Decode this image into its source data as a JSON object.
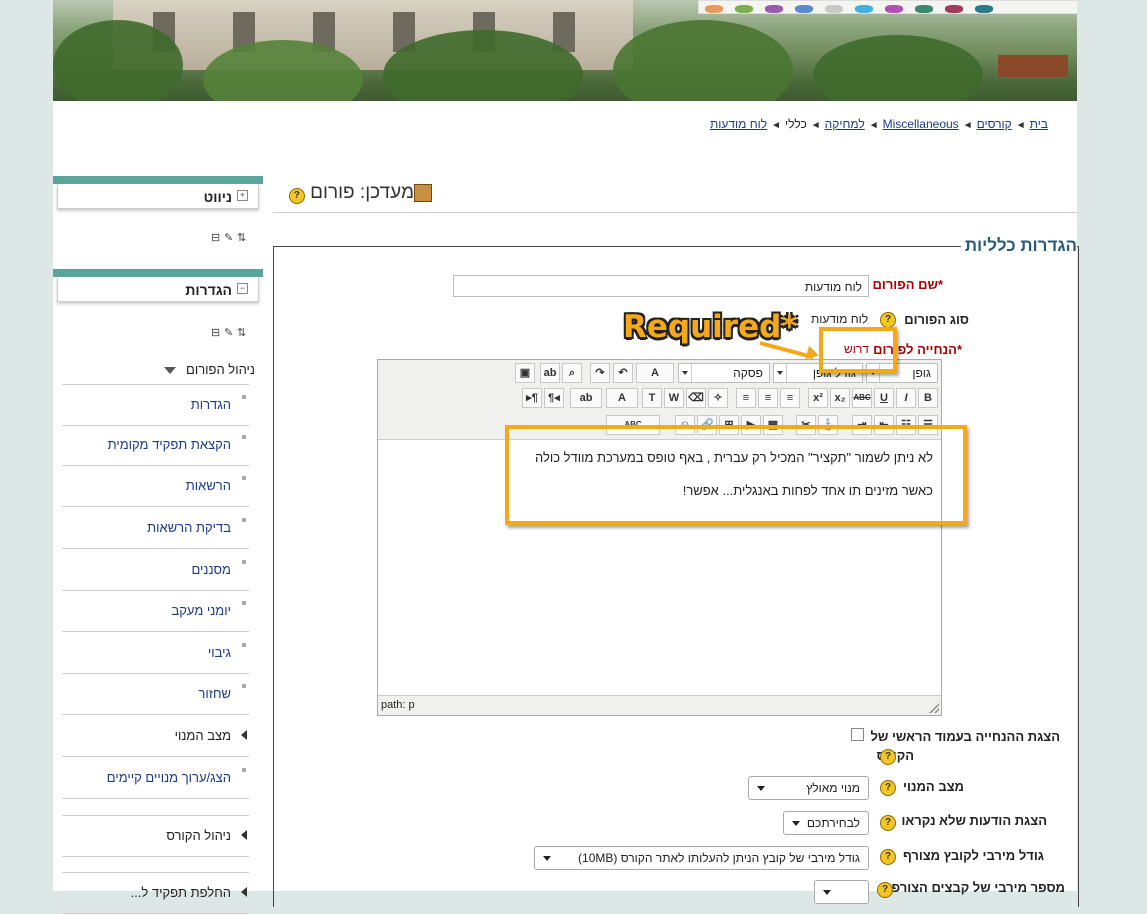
{
  "breadcrumb": {
    "items": [
      "בית",
      "קורסים",
      "Miscellaneous",
      "למחיקה"
    ],
    "current": "כללי",
    "last": "לוח מודעות",
    "separator": "◄"
  },
  "sidebar": {
    "nav_block_title": "ניווט",
    "settings_block_title": "הגדרות",
    "forum_admin_heading": "ניהול הפורום",
    "forum_admin_items": [
      "הגדרות",
      "הקצאת תפקיד מקומית",
      "הרשאות",
      "בדיקת הרשאות",
      "מסננים",
      "יומני מעקב",
      "גיבוי",
      "שחזור"
    ],
    "menu_state_label": "מצב המנוי",
    "show_edit_subscribers": "הצג/ערוך מנויים קיימים",
    "course_admin": "ניהול הקורס",
    "switch_role_partial": "החלפת תפקיד ל..."
  },
  "page": {
    "title": "מעדכן: פורום",
    "section_legend": "הגדרות כלליות"
  },
  "form": {
    "forum_name_label": "שם הפורום",
    "forum_name_value": "לוח מודעות",
    "forum_type_label": "סוג הפורום",
    "forum_type_value": "לוח מודעות",
    "intro_label": "הנחייה לפורום",
    "required_marker": "*",
    "required_text": "דרוש",
    "show_on_course_label_1": "הצגת ההנחייה בעמוד הראשי של",
    "show_on_course_label_2": "הקורס",
    "subscription_label": "מצב המנוי",
    "subscription_value": "מנוי מאולץ",
    "unread_label": "הצגת הודעות שלא נקראו",
    "unread_value": "לבחירתכם",
    "max_attach_label": "גודל מירבי לקובץ מצורף",
    "max_attach_value": "גודל מירבי של קובץ הניתן להעלותו לאתר הקורס (10MB)",
    "max_attach_count_label_partial": "מספר מירבי של קבצים הצורפ"
  },
  "editor": {
    "font_select": "גופן",
    "size_select": "גודל גופן",
    "format_select": "פסקה",
    "body_line1": "לא ניתן לשמור \"תקציר\" המכיל  רק עברית , באף טופס במערכת מוודל כולה",
    "body_line2": "כאשר מזינים תו אחד לפחות באנגלית... אפשר!",
    "path_label": "path: p"
  },
  "annotation": {
    "callout_text": "Required*",
    "color": "#f4a81c"
  },
  "help_glyph": "?",
  "colors": {
    "sidebar_bar": "#5aa59a",
    "link": "#1a3a8a",
    "required": "#a00000",
    "legend": "#2a5a7a"
  }
}
